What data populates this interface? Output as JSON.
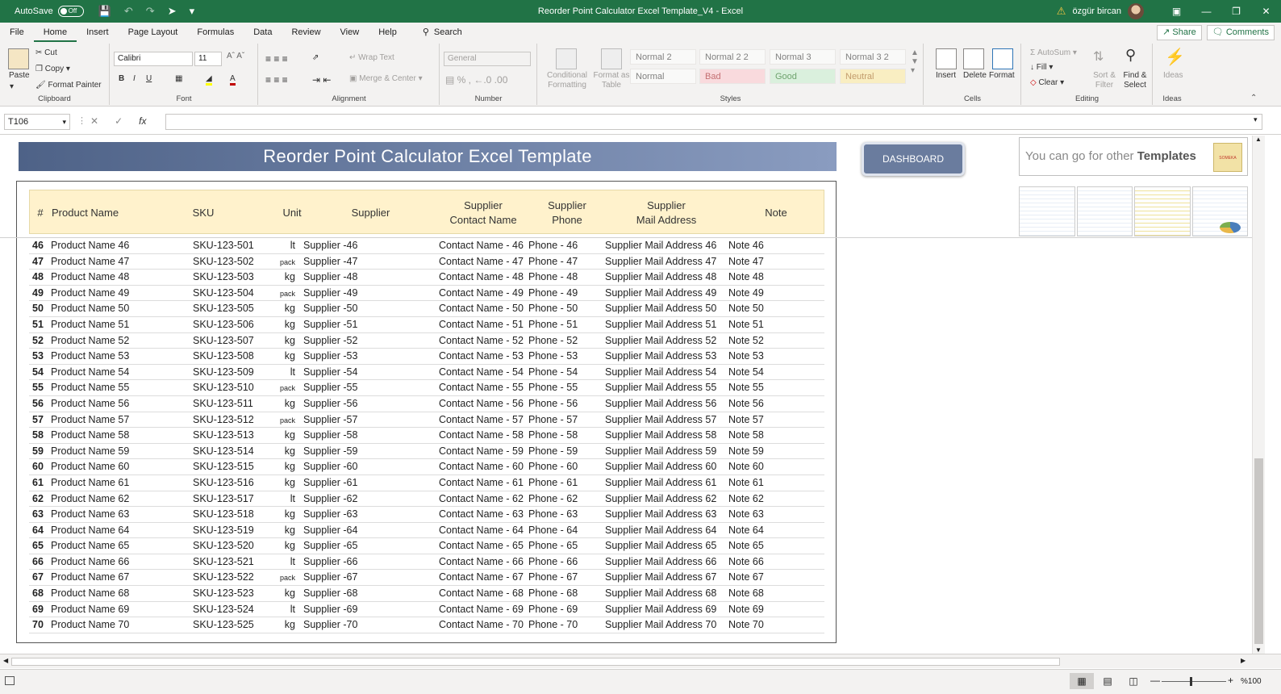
{
  "titlebar": {
    "autosave_label": "AutoSave",
    "autosave_state": "Off",
    "doc_title": "Reorder Point Calculator Excel Template_V4  -  Excel",
    "user_name": "özgür bircan"
  },
  "menu": {
    "tabs": [
      "File",
      "Home",
      "Insert",
      "Page Layout",
      "Formulas",
      "Data",
      "Review",
      "View",
      "Help"
    ],
    "active_tab": "Home",
    "search_label": "Search",
    "share_label": "Share",
    "comments_label": "Comments"
  },
  "ribbon": {
    "clipboard": {
      "paste": "Paste",
      "cut": "Cut",
      "copy": "Copy",
      "format_painter": "Format Painter",
      "label": "Clipboard"
    },
    "font": {
      "font_name": "Calibri",
      "font_size": "11",
      "label": "Font"
    },
    "alignment": {
      "wrap_text": "Wrap Text",
      "merge_center": "Merge & Center",
      "label": "Alignment"
    },
    "number": {
      "format": "General",
      "label": "Number"
    },
    "styles": {
      "conditional_formatting": "Conditional Formatting",
      "format_as_table": "Format as Table",
      "cells": [
        "Normal 2",
        "Normal 2 2",
        "Normal 3",
        "Normal 3 2",
        "Normal",
        "Bad",
        "Good",
        "Neutral"
      ],
      "label": "Styles"
    },
    "cells": {
      "insert": "Insert",
      "delete": "Delete",
      "format": "Format",
      "label": "Cells"
    },
    "editing": {
      "autosum": "AutoSum",
      "fill": "Fill",
      "clear": "Clear",
      "sort_filter": "Sort & Filter",
      "find_select": "Find & Select",
      "label": "Editing"
    },
    "ideas": {
      "ideas": "Ideas",
      "label": "Ideas"
    }
  },
  "formula_bar": {
    "name_box": "T106",
    "fx": "fx",
    "value": ""
  },
  "sheet": {
    "banner": "Reorder Point Calculator Excel Template",
    "dashboard_button": "DASHBOARD",
    "promo_text": "You can go for other",
    "promo_bold": "Templates",
    "promo_logo": "SOMEKA",
    "headers": {
      "num": "#",
      "name": "Product Name",
      "sku": "SKU",
      "unit": "Unit",
      "supplier": "Supplier",
      "contact": "Supplier\nContact Name",
      "phone": "Supplier\nPhone",
      "address": "Supplier\nMail Address",
      "note": "Note"
    },
    "rows": [
      {
        "num": "46",
        "name": "Product Name 46",
        "sku": "SKU-123-501",
        "unit": "lt",
        "supplier": "Supplier -46",
        "contact": "Contact Name - 46",
        "phone": "Phone - 46",
        "address": "Supplier Mail Address 46",
        "note": "Note 46"
      },
      {
        "num": "47",
        "name": "Product Name 47",
        "sku": "SKU-123-502",
        "unit": "pack",
        "supplier": "Supplier -47",
        "contact": "Contact Name - 47",
        "phone": "Phone - 47",
        "address": "Supplier Mail Address 47",
        "note": "Note 47"
      },
      {
        "num": "48",
        "name": "Product Name 48",
        "sku": "SKU-123-503",
        "unit": "kg",
        "supplier": "Supplier -48",
        "contact": "Contact Name - 48",
        "phone": "Phone - 48",
        "address": "Supplier Mail Address 48",
        "note": "Note 48"
      },
      {
        "num": "49",
        "name": "Product Name 49",
        "sku": "SKU-123-504",
        "unit": "pack",
        "supplier": "Supplier -49",
        "contact": "Contact Name - 49",
        "phone": "Phone - 49",
        "address": "Supplier Mail Address 49",
        "note": "Note 49"
      },
      {
        "num": "50",
        "name": "Product Name 50",
        "sku": "SKU-123-505",
        "unit": "kg",
        "supplier": "Supplier -50",
        "contact": "Contact Name - 50",
        "phone": "Phone - 50",
        "address": "Supplier Mail Address 50",
        "note": "Note 50"
      },
      {
        "num": "51",
        "name": "Product Name 51",
        "sku": "SKU-123-506",
        "unit": "kg",
        "supplier": "Supplier -51",
        "contact": "Contact Name - 51",
        "phone": "Phone - 51",
        "address": "Supplier Mail Address 51",
        "note": "Note 51"
      },
      {
        "num": "52",
        "name": "Product Name 52",
        "sku": "SKU-123-507",
        "unit": "kg",
        "supplier": "Supplier -52",
        "contact": "Contact Name - 52",
        "phone": "Phone - 52",
        "address": "Supplier Mail Address 52",
        "note": "Note 52"
      },
      {
        "num": "53",
        "name": "Product Name 53",
        "sku": "SKU-123-508",
        "unit": "kg",
        "supplier": "Supplier -53",
        "contact": "Contact Name - 53",
        "phone": "Phone - 53",
        "address": "Supplier Mail Address 53",
        "note": "Note 53"
      },
      {
        "num": "54",
        "name": "Product Name 54",
        "sku": "SKU-123-509",
        "unit": "lt",
        "supplier": "Supplier -54",
        "contact": "Contact Name - 54",
        "phone": "Phone - 54",
        "address": "Supplier Mail Address 54",
        "note": "Note 54"
      },
      {
        "num": "55",
        "name": "Product Name 55",
        "sku": "SKU-123-510",
        "unit": "pack",
        "supplier": "Supplier -55",
        "contact": "Contact Name - 55",
        "phone": "Phone - 55",
        "address": "Supplier Mail Address 55",
        "note": "Note 55"
      },
      {
        "num": "56",
        "name": "Product Name 56",
        "sku": "SKU-123-511",
        "unit": "kg",
        "supplier": "Supplier -56",
        "contact": "Contact Name - 56",
        "phone": "Phone - 56",
        "address": "Supplier Mail Address 56",
        "note": "Note 56"
      },
      {
        "num": "57",
        "name": "Product Name 57",
        "sku": "SKU-123-512",
        "unit": "pack",
        "supplier": "Supplier -57",
        "contact": "Contact Name - 57",
        "phone": "Phone - 57",
        "address": "Supplier Mail Address 57",
        "note": "Note 57"
      },
      {
        "num": "58",
        "name": "Product Name 58",
        "sku": "SKU-123-513",
        "unit": "kg",
        "supplier": "Supplier -58",
        "contact": "Contact Name - 58",
        "phone": "Phone - 58",
        "address": "Supplier Mail Address 58",
        "note": "Note 58"
      },
      {
        "num": "59",
        "name": "Product Name 59",
        "sku": "SKU-123-514",
        "unit": "kg",
        "supplier": "Supplier -59",
        "contact": "Contact Name - 59",
        "phone": "Phone - 59",
        "address": "Supplier Mail Address 59",
        "note": "Note 59"
      },
      {
        "num": "60",
        "name": "Product Name 60",
        "sku": "SKU-123-515",
        "unit": "kg",
        "supplier": "Supplier -60",
        "contact": "Contact Name - 60",
        "phone": "Phone - 60",
        "address": "Supplier Mail Address 60",
        "note": "Note 60"
      },
      {
        "num": "61",
        "name": "Product Name 61",
        "sku": "SKU-123-516",
        "unit": "kg",
        "supplier": "Supplier -61",
        "contact": "Contact Name - 61",
        "phone": "Phone - 61",
        "address": "Supplier Mail Address 61",
        "note": "Note 61"
      },
      {
        "num": "62",
        "name": "Product Name 62",
        "sku": "SKU-123-517",
        "unit": "lt",
        "supplier": "Supplier -62",
        "contact": "Contact Name - 62",
        "phone": "Phone - 62",
        "address": "Supplier Mail Address 62",
        "note": "Note 62"
      },
      {
        "num": "63",
        "name": "Product Name 63",
        "sku": "SKU-123-518",
        "unit": "kg",
        "supplier": "Supplier -63",
        "contact": "Contact Name - 63",
        "phone": "Phone - 63",
        "address": "Supplier Mail Address 63",
        "note": "Note 63"
      },
      {
        "num": "64",
        "name": "Product Name 64",
        "sku": "SKU-123-519",
        "unit": "kg",
        "supplier": "Supplier -64",
        "contact": "Contact Name - 64",
        "phone": "Phone - 64",
        "address": "Supplier Mail Address 64",
        "note": "Note 64"
      },
      {
        "num": "65",
        "name": "Product Name 65",
        "sku": "SKU-123-520",
        "unit": "kg",
        "supplier": "Supplier -65",
        "contact": "Contact Name - 65",
        "phone": "Phone - 65",
        "address": "Supplier Mail Address 65",
        "note": "Note 65"
      },
      {
        "num": "66",
        "name": "Product Name 66",
        "sku": "SKU-123-521",
        "unit": "lt",
        "supplier": "Supplier -66",
        "contact": "Contact Name - 66",
        "phone": "Phone - 66",
        "address": "Supplier Mail Address 66",
        "note": "Note 66"
      },
      {
        "num": "67",
        "name": "Product Name 67",
        "sku": "SKU-123-522",
        "unit": "pack",
        "supplier": "Supplier -67",
        "contact": "Contact Name - 67",
        "phone": "Phone - 67",
        "address": "Supplier Mail Address 67",
        "note": "Note 67"
      },
      {
        "num": "68",
        "name": "Product Name 68",
        "sku": "SKU-123-523",
        "unit": "kg",
        "supplier": "Supplier -68",
        "contact": "Contact Name - 68",
        "phone": "Phone - 68",
        "address": "Supplier Mail Address 68",
        "note": "Note 68"
      },
      {
        "num": "69",
        "name": "Product Name 69",
        "sku": "SKU-123-524",
        "unit": "lt",
        "supplier": "Supplier -69",
        "contact": "Contact Name - 69",
        "phone": "Phone - 69",
        "address": "Supplier Mail Address 69",
        "note": "Note 69"
      },
      {
        "num": "70",
        "name": "Product Name 70",
        "sku": "SKU-123-525",
        "unit": "kg",
        "supplier": "Supplier -70",
        "contact": "Contact Name - 70",
        "phone": "Phone - 70",
        "address": "Supplier Mail Address 70",
        "note": "Note 70"
      }
    ]
  },
  "status": {
    "zoom": "%100"
  },
  "colors": {
    "excel_green": "#217346",
    "header_fill": "#fff2cc",
    "banner_start": "#4e6287",
    "banner_end": "#8a9cc0"
  }
}
